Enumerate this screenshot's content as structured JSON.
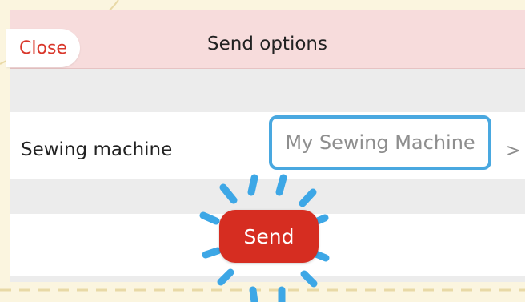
{
  "header": {
    "title": "Send options",
    "close_label": "Close"
  },
  "setting": {
    "label": "Sewing machine",
    "value": "My Sewing Machine",
    "chevron": ">"
  },
  "action": {
    "send_label": "Send"
  },
  "colors": {
    "header_bg": "#f7dcdc",
    "accent_red": "#d62d21",
    "highlight_blue": "#49a8e0",
    "page_bg": "#fbf5df"
  },
  "icons": {
    "chevron": "chevron-right-icon",
    "highlight": "highlight-burst-icon"
  }
}
